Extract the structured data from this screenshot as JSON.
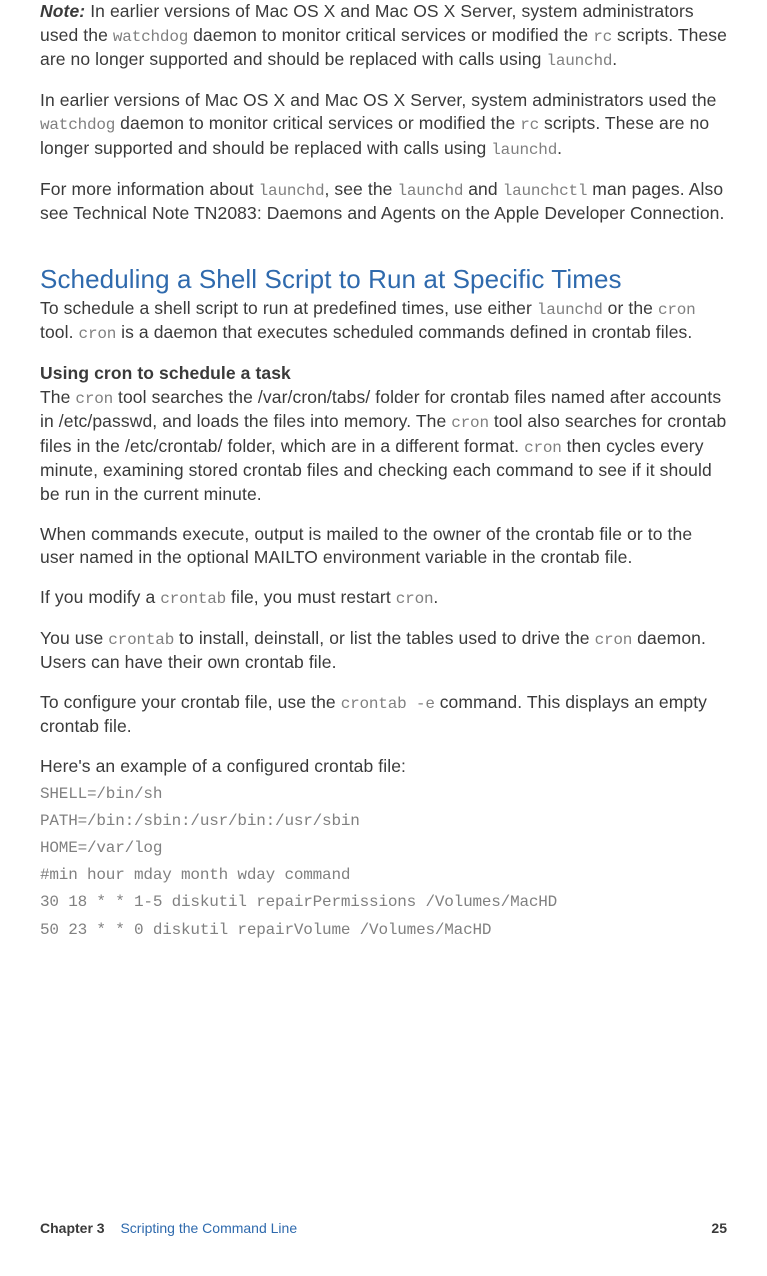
{
  "note": {
    "label": "Note:",
    "p1_a": "In earlier versions of Mac OS X and Mac OS X Server, system administrators used the ",
    "p1_code1": "watchdog",
    "p1_b": " daemon to monitor critical services or modified the ",
    "p1_code2": "rc",
    "p1_c": " scripts. These are no longer supported and should be replaced with calls using ",
    "p1_code3": "launchd",
    "p1_d": "."
  },
  "p2": {
    "a": "In earlier versions of Mac OS X and Mac OS X Server, system administrators used the ",
    "code1": "watchdog",
    "b": " daemon to monitor critical services or modified the ",
    "code2": "rc",
    "c": " scripts. These are no longer supported and should be replaced with calls using ",
    "code3": "launchd",
    "d": "."
  },
  "p3": {
    "a": "For more information about ",
    "code1": "launchd",
    "b": ", see the ",
    "code2": "launchd",
    "c": " and ",
    "code3": "launchctl",
    "d": " man pages. Also see Technical Note TN2083: Daemons and Agents on the Apple Developer Connection."
  },
  "section_heading": "Scheduling a Shell Script to Run at Specific Times",
  "p4": {
    "a": "To schedule a shell script to run at predefined times, use either ",
    "code1": "launchd",
    "b": " or the ",
    "code2": "cron",
    "c": " tool. ",
    "code3": "cron",
    "d": " is a daemon that executes scheduled commands defined in crontab files."
  },
  "subhead": "Using cron to schedule a task",
  "p5": {
    "a": "The ",
    "code1": "cron",
    "b": " tool searches the /var/cron/tabs/ folder for crontab files named after accounts in /etc/passwd, and loads the files into memory. The ",
    "code2": "cron",
    "c": " tool also searches for crontab files in the /etc/crontab/ folder, which are in a different format. ",
    "code3": "cron",
    "d": " then cycles every minute, examining stored crontab files and checking each command to see if it should be run in the current minute."
  },
  "p6": "When commands execute, output is mailed to the owner of the crontab file or to the user named in the optional MAILTO environment variable in the crontab file.",
  "p7": {
    "a": "If you modify a ",
    "code1": "crontab",
    "b": " file, you must restart ",
    "code2": "cron",
    "c": "."
  },
  "p8": {
    "a": "You use ",
    "code1": "crontab",
    "b": " to install, deinstall, or list the tables used to drive the ",
    "code2": "cron",
    "c": " daemon. Users can have their own crontab file."
  },
  "p9": {
    "a": "To configure your crontab file, use the ",
    "code1": "crontab -e",
    "b": " command. This displays an empty crontab file."
  },
  "p10": "Here's an example of a configured crontab file:",
  "codeblock": "SHELL=/bin/sh\nPATH=/bin:/sbin:/usr/bin:/usr/sbin\nHOME=/var/log\n#min hour mday month wday command\n30 18 * * 1-5 diskutil repairPermissions /Volumes/MacHD\n50 23 * * 0 diskutil repairVolume /Volumes/MacHD",
  "footer": {
    "chapter": "Chapter 3",
    "title": "Scripting the Command Line",
    "page": "25"
  }
}
